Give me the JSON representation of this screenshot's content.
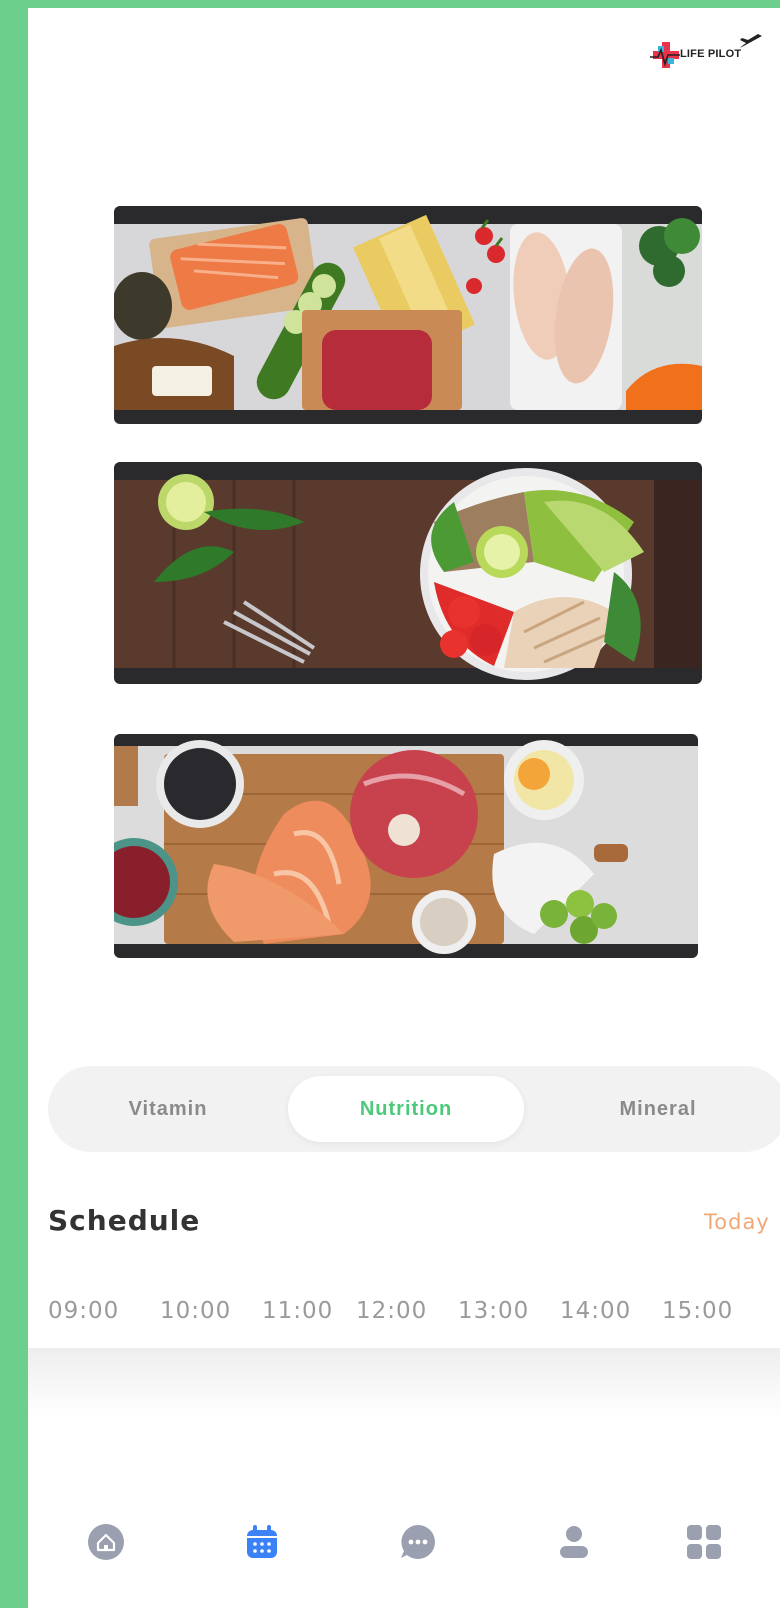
{
  "app": {
    "logo_text": "LIFE PILOT"
  },
  "images": [
    {
      "name": "food-image-1",
      "icon": "protein-ingredients-image"
    },
    {
      "name": "food-image-2",
      "icon": "salad-bowl-image"
    },
    {
      "name": "food-image-3",
      "icon": "meat-fish-ingredients-image"
    }
  ],
  "tabs": [
    {
      "label": "Vitamin",
      "active": false
    },
    {
      "label": "Nutrition",
      "active": true
    },
    {
      "label": "Mineral",
      "active": false
    }
  ],
  "schedule": {
    "title": "Schedule",
    "today_label": "Today",
    "times": [
      "09:00",
      "10:00",
      "11:00",
      "12:00",
      "13:00",
      "14:00",
      "15:00"
    ]
  },
  "nav": [
    {
      "icon": "home-icon",
      "active": false
    },
    {
      "icon": "calendar-icon",
      "active": true
    },
    {
      "icon": "chat-icon",
      "active": false
    },
    {
      "icon": "profile-icon",
      "active": false
    },
    {
      "icon": "grid-icon",
      "active": false
    }
  ],
  "colors": {
    "frame": "#6ccf8c",
    "accent": "#4cc97a",
    "today": "#f0a878",
    "nav_active": "#3b82f6",
    "nav_inactive": "#9aa0b0"
  }
}
